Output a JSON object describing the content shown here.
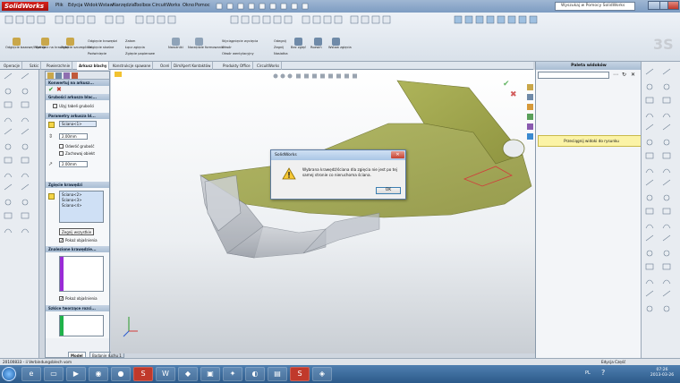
{
  "app": {
    "logo": "SolidWorks",
    "menu": [
      "Plik",
      "Edycja",
      "Widok",
      "Wstaw",
      "Narzędzia",
      "Toolbox",
      "CircuitWorks",
      "Okno",
      "Pomoc"
    ],
    "search_placeholder": "Wyszukaj w Pomocy SolidWorks"
  },
  "ribbon": {
    "groups": [
      {
        "label": "Odgięcie bazowe/Występ"
      },
      {
        "label": "Kołnierz na krawędzi"
      },
      {
        "label": "Zgięcie szczególne"
      },
      {
        "label": "Odgięcie krawędzi"
      },
      {
        "label": "Odgięcie skośne"
      },
      {
        "label": "Podwinięcie"
      },
      {
        "label": "Załam"
      },
      {
        "label": "Łącz zgięcia"
      },
      {
        "label": "Zgięcie papierowe"
      },
      {
        "label": "Narożniki"
      },
      {
        "label": "Narzędzie formowania"
      },
      {
        "label": "Wyciągnięcie wycięcia"
      },
      {
        "label": "Otwór"
      },
      {
        "label": "Otwór wentylacyjny"
      },
      {
        "label": "Odegnij"
      },
      {
        "label": "Zegnij"
      },
      {
        "label": "Bez zgięć"
      },
      {
        "label": "Rozwiń"
      },
      {
        "label": "Nasiatka"
      },
      {
        "label": "Wstaw zgięcia"
      }
    ]
  },
  "tabs": [
    "Operacje",
    "Szkic",
    "Powierzchnie",
    "Arkusz blachy",
    "Konstrukcje spawane",
    "Oceń",
    "DimXpert Kontaktów",
    "Produkty Office",
    "CircuitWorks"
  ],
  "active_tab": "Arkusz blachy",
  "property_manager": {
    "title": "Konwertuj na arkusz...",
    "sections": {
      "thickness": {
        "title": "Grubości arkusza blac...",
        "use_table": "Użyj tabeli grubości"
      },
      "params": {
        "title": "Parametry arkusza bl...",
        "face": "Ściana<1>",
        "thickness_value": "2.00mm",
        "reverse_label": "Odwróć grubość",
        "keep_body_label": "Zachowaj obiekt",
        "radius_value": "2.00mm"
      },
      "bend_edges": {
        "title": "Zgięcie krawędzi",
        "items": [
          "Ściana<2>",
          "Ściana<3>",
          "Ściana<4>"
        ],
        "button": "Zegnij wszystkie",
        "show_callouts": "Pokaż objaśnienia"
      },
      "found_edges": {
        "title": "Znalezione krawędzie...",
        "show_callouts": "Pokaż objaśnienia"
      },
      "sketches": {
        "title": "Szkice tworzące rozci..."
      }
    },
    "bottom_tabs": [
      "Model",
      "Badanie ruchu 1"
    ]
  },
  "palette": {
    "title": "Paleta widoków",
    "drag_hint": "Przeciągnij widoki do rysunku"
  },
  "dialog": {
    "title": "SolidWorks",
    "message": "Wybrana krawędź/ściana dla zgięcia nie jest po tej samej stronie co nieruchoma ściana.",
    "ok": "OK"
  },
  "status": {
    "left": "20100833 - ii Verbindungsblech vom",
    "right": "Edycja Część"
  },
  "taskbar": {
    "lang": "PL",
    "time": "07:26",
    "date": "2013-03-26"
  },
  "colors": {
    "part": "#9aa04a",
    "dialog_border": "#5c7aa0",
    "accent_red": "#c0392b"
  }
}
